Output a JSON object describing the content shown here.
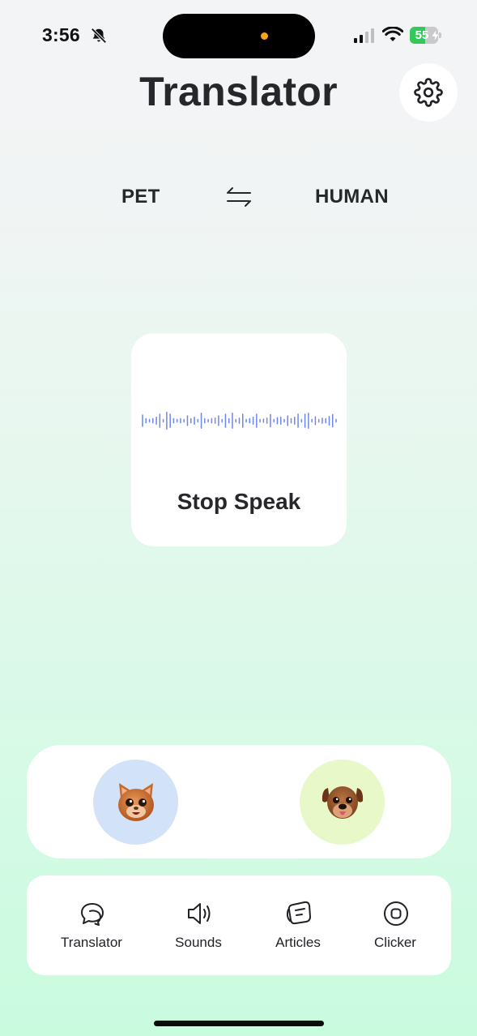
{
  "status_bar": {
    "time": "3:56",
    "battery_percent": 55,
    "battery_text": "55",
    "icons": [
      "bell-slash-icon",
      "signal-icon",
      "wifi-icon",
      "battery-charging-icon"
    ],
    "island_dot_color": "#f7a21b"
  },
  "header": {
    "title": "Translator",
    "settings_icon": "gear-icon"
  },
  "language_switch": {
    "from": "PET",
    "to": "HUMAN",
    "swap_icon": "swap-arrows-icon"
  },
  "record_card": {
    "label": "Stop Speak",
    "waveform_color": "#6d86ee",
    "waveform_levels": [
      0.7,
      0.3,
      0.2,
      0.3,
      0.45,
      0.8,
      0.2,
      1.0,
      0.8,
      0.3,
      0.2,
      0.3,
      0.2,
      0.6,
      0.3,
      0.45,
      0.2,
      0.9,
      0.3,
      0.2,
      0.3,
      0.35,
      0.6,
      0.2,
      0.8,
      0.3,
      0.9,
      0.2,
      0.35,
      0.8,
      0.2,
      0.3,
      0.45,
      0.8,
      0.2,
      0.25,
      0.35,
      0.75,
      0.2,
      0.4,
      0.45,
      0.2,
      0.6,
      0.3,
      0.45,
      0.8,
      0.2,
      0.8,
      0.9,
      0.2,
      0.5,
      0.2,
      0.35,
      0.3,
      0.55,
      0.75,
      0.2
    ]
  },
  "pets": [
    {
      "name": "cat",
      "icon": "cat-face-icon",
      "color": "#d2e3f9"
    },
    {
      "name": "dog",
      "icon": "dog-face-icon",
      "color": "#e9f8c9"
    }
  ],
  "nav": {
    "items": [
      {
        "label": "Translator",
        "icon": "chat-bubbles-icon"
      },
      {
        "label": "Sounds",
        "icon": "speaker-icon"
      },
      {
        "label": "Articles",
        "icon": "article-icon"
      },
      {
        "label": "Clicker",
        "icon": "clicker-icon"
      }
    ]
  }
}
